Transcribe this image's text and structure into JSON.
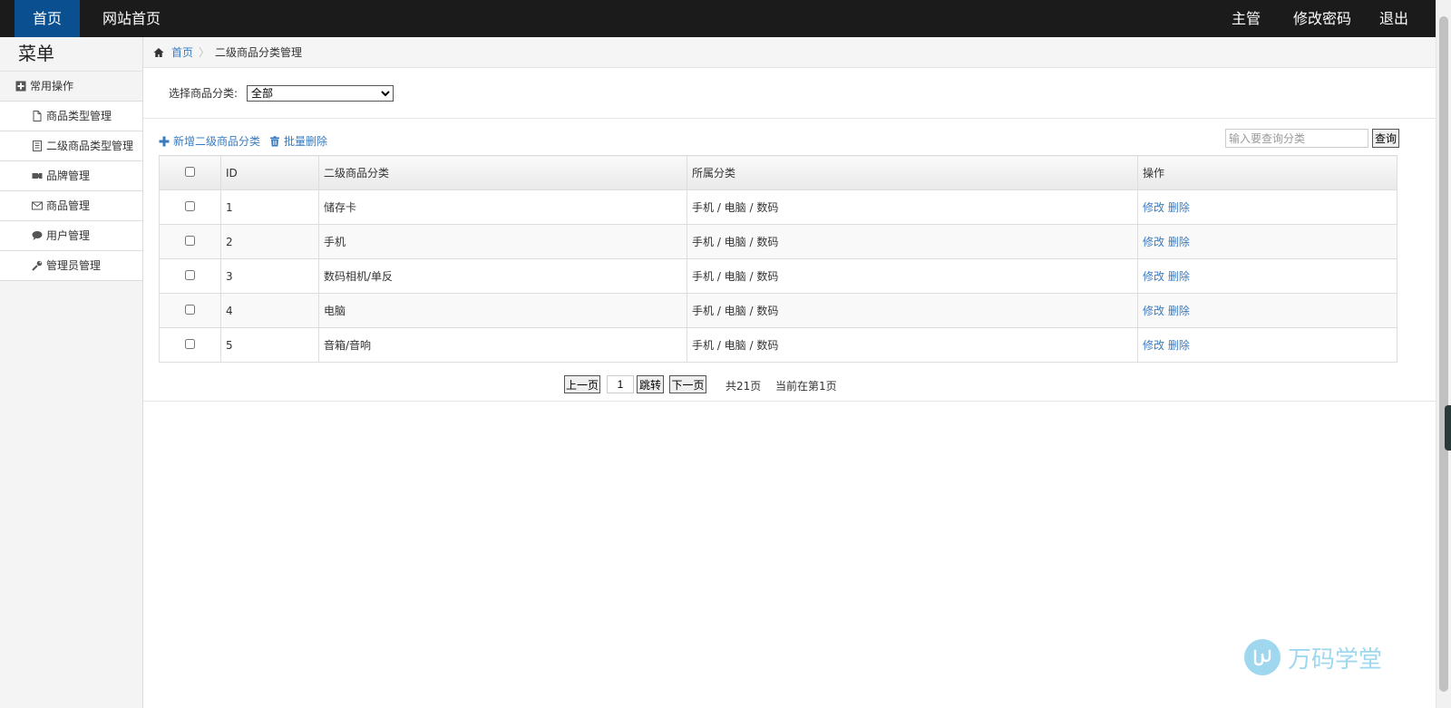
{
  "topbar": {
    "home": "首页",
    "site_home": "网站首页",
    "user": "主管",
    "change_password": "修改密码",
    "logout": "退出",
    "colors": {
      "bar": "#1b1b1b",
      "active": "#0a4f8f"
    }
  },
  "sidebar": {
    "title": "菜单",
    "group": {
      "label": "常用操作",
      "icon": "plus-square-icon"
    },
    "items": [
      {
        "label": "商品类型管理",
        "icon": "file-icon"
      },
      {
        "label": "二级商品类型管理",
        "icon": "list-icon"
      },
      {
        "label": "品牌管理",
        "icon": "tag-icon"
      },
      {
        "label": "商品管理",
        "icon": "mail-icon"
      },
      {
        "label": "用户管理",
        "icon": "chat-icon"
      },
      {
        "label": "管理员管理",
        "icon": "wrench-icon"
      }
    ]
  },
  "breadcrumb": {
    "home": "首页",
    "current": "二级商品分类管理"
  },
  "filter": {
    "label": "选择商品分类:",
    "selected": "全部"
  },
  "actions": {
    "add": "新增二级商品分类",
    "batch_delete": "批量删除"
  },
  "search": {
    "placeholder": "输入要查询分类",
    "button": "查询"
  },
  "table": {
    "headers": [
      "ID",
      "二级商品分类",
      "所属分类",
      "操作"
    ],
    "rows": [
      {
        "id": "1",
        "name": "储存卡",
        "parent": "手机 / 电脑 / 数码"
      },
      {
        "id": "2",
        "name": "手机",
        "parent": "手机 / 电脑 / 数码"
      },
      {
        "id": "3",
        "name": "数码相机/单反",
        "parent": "手机 / 电脑 / 数码"
      },
      {
        "id": "4",
        "name": "电脑",
        "parent": "手机 / 电脑 / 数码"
      },
      {
        "id": "5",
        "name": "音箱/音响",
        "parent": "手机 / 电脑 / 数码"
      }
    ],
    "edit_label": "修改",
    "delete_label": "删除"
  },
  "pager": {
    "prev": "上一页",
    "page_value": "1",
    "jump": "跳转",
    "next": "下一页",
    "total": "共21页",
    "current": "当前在第1页"
  },
  "watermark": {
    "text": "万码学堂"
  },
  "colors": {
    "link": "#3a7bbf",
    "watermark": "#9fd8ee"
  }
}
